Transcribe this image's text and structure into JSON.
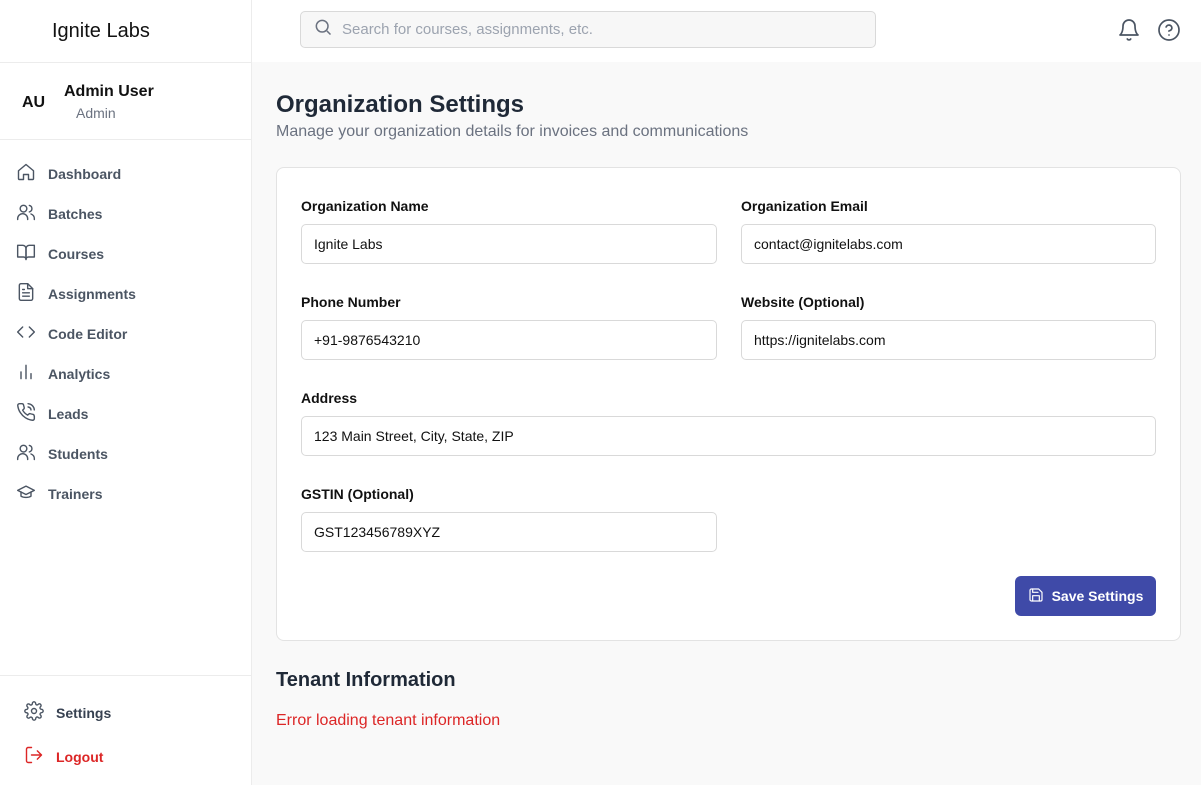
{
  "brand": {
    "name": "Ignite Labs"
  },
  "user": {
    "initials": "AU",
    "name": "Admin User",
    "role": "Admin"
  },
  "sidebar": {
    "items": [
      {
        "label": "Dashboard",
        "icon": "home-icon"
      },
      {
        "label": "Batches",
        "icon": "users-icon"
      },
      {
        "label": "Courses",
        "icon": "book-open-icon"
      },
      {
        "label": "Assignments",
        "icon": "file-text-icon"
      },
      {
        "label": "Code Editor",
        "icon": "code-icon"
      },
      {
        "label": "Analytics",
        "icon": "bar-chart-icon"
      },
      {
        "label": "Leads",
        "icon": "phone-call-icon"
      },
      {
        "label": "Students",
        "icon": "users-icon"
      },
      {
        "label": "Trainers",
        "icon": "graduation-cap-icon"
      }
    ],
    "settings_label": "Settings",
    "logout_label": "Logout"
  },
  "search": {
    "placeholder": "Search for courses, assignments, etc."
  },
  "header": {
    "icons": [
      "bell-icon",
      "help-circle-icon"
    ]
  },
  "page": {
    "title": "Organization Settings",
    "subtitle": "Manage your organization details for invoices and communications"
  },
  "form": {
    "org_name": {
      "label": "Organization Name",
      "value": "Ignite Labs"
    },
    "org_email": {
      "label": "Organization Email",
      "value": "contact@ignitelabs.com"
    },
    "phone": {
      "label": "Phone Number",
      "value": "+91-9876543210"
    },
    "website": {
      "label": "Website (Optional)",
      "value": "https://ignitelabs.com"
    },
    "address": {
      "label": "Address",
      "value": "123 Main Street, City, State, ZIP"
    },
    "gstin": {
      "label": "GSTIN (Optional)",
      "value": "GST123456789XYZ"
    },
    "save_label": "Save Settings"
  },
  "tenant": {
    "title": "Tenant Information",
    "error": "Error loading tenant information"
  },
  "colors": {
    "primary": "#3f4aa8",
    "danger": "#dc2626",
    "muted": "#6b7280"
  }
}
